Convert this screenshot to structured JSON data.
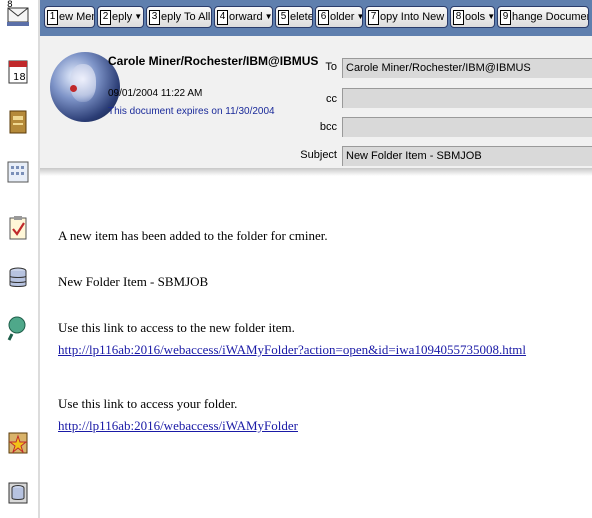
{
  "toolbar": {
    "buttons": [
      {
        "accel": "1",
        "label": "ew Memo",
        "dropdown": false
      },
      {
        "accel": "2",
        "label": "eply",
        "dropdown": true
      },
      {
        "accel": "3",
        "label": "eply To All",
        "dropdown": true
      },
      {
        "accel": "4",
        "label": "orward",
        "dropdown": true
      },
      {
        "accel": "5",
        "label": "elete",
        "dropdown": false
      },
      {
        "accel": "6",
        "label": "older",
        "dropdown": true
      },
      {
        "accel": "7",
        "label": "opy Into New",
        "dropdown": true
      },
      {
        "accel": "8",
        "label": "ools",
        "dropdown": true
      },
      {
        "accel": "9",
        "label": "hange Document Expiration",
        "dropdown": false
      }
    ],
    "dropdown_glyph": "▼"
  },
  "sidebar": {
    "top_badge": "8",
    "icons": [
      "mail-icon",
      "calendar-icon",
      "address-book-icon",
      "planner-icon",
      "todo-icon",
      "database-icon",
      "search-icon",
      "favorites-icon",
      "databases-icon"
    ]
  },
  "header": {
    "from": "Carole Miner/Rochester/IBM@IBMUS",
    "date": "09/01/2004 11:22 AM",
    "expires": "This document expires on 11/30/2004",
    "labels": {
      "to": "To",
      "cc": "cc",
      "bcc": "bcc",
      "subject": "Subject"
    },
    "to": "Carole Miner/Rochester/IBM@IBMUS",
    "cc": "",
    "bcc": "",
    "subject": "New Folder Item - SBMJOB"
  },
  "body": {
    "line1": "A new item has been added to the folder for cminer.",
    "line2": "New Folder Item - SBMJOB",
    "line3": "Use this link to access to the new folder item.",
    "link1": "http://lp116ab:2016/webaccess/iWAMyFolder?action=open&id=iwa1094055735008.html",
    "line4": "Use this link to access your folder.",
    "link2": "http://lp116ab:2016/webaccess/iWAMyFolder"
  },
  "colors": {
    "actionbar": "#5f7fae",
    "link": "#1a1aa6",
    "expires_text": "#1a2a9a",
    "field_bg": "#d9d9d9"
  }
}
